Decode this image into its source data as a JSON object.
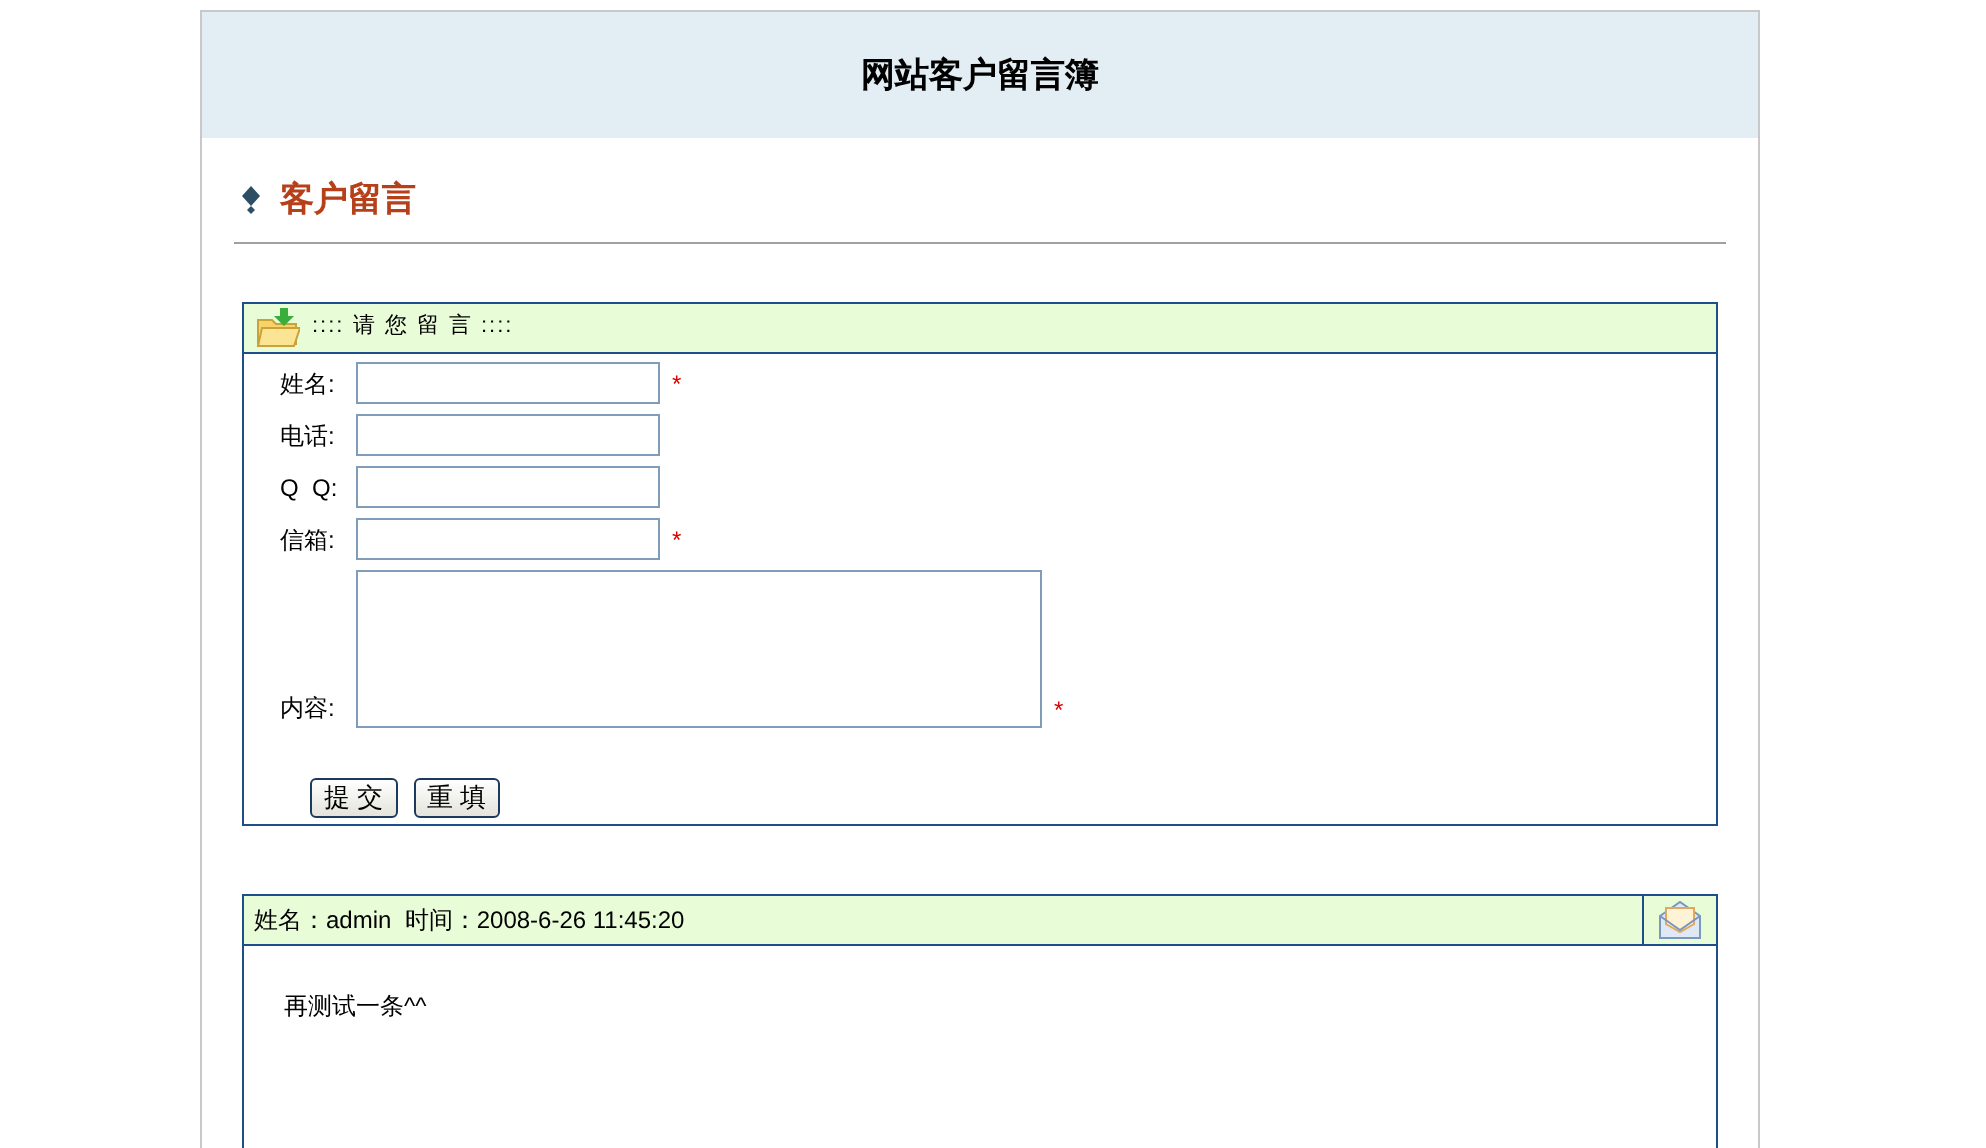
{
  "title": "网站客户留言簿",
  "section_title": "客户留言",
  "form": {
    "title": ":::: 请 您 留 言 ::::",
    "required_mark": "*",
    "fields": [
      {
        "kind": "input",
        "label": "姓名:",
        "required": true
      },
      {
        "kind": "input",
        "label": "电话:",
        "required": false
      },
      {
        "kind": "input",
        "label": "Q  Q:",
        "required": false
      },
      {
        "kind": "input",
        "label": "信箱:",
        "required": true
      },
      {
        "kind": "textarea",
        "label": "内容:",
        "required": true
      }
    ],
    "buttons": [
      "提 交",
      "重 填"
    ]
  },
  "messages": [
    {
      "header": "姓名：admin  时间：2008-6-26 11:45:20",
      "content": "再测试一条^^"
    }
  ]
}
